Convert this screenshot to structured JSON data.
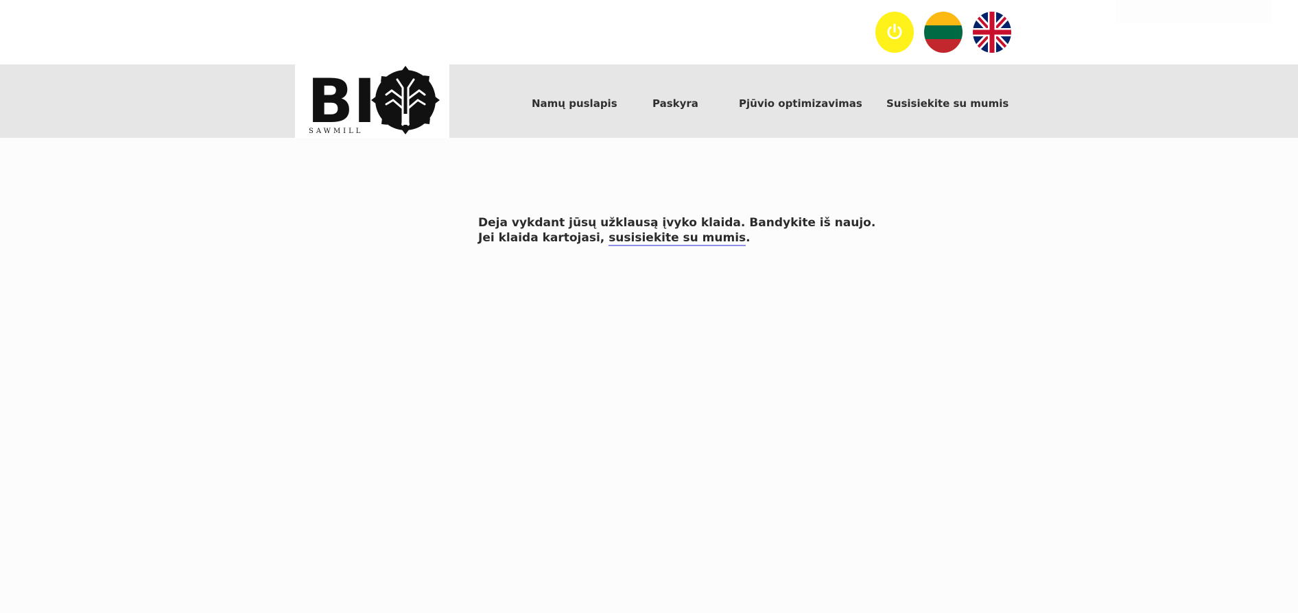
{
  "logo": {
    "text_main": "BI",
    "text_sub": "SAWMILL"
  },
  "nav": {
    "items": [
      {
        "label": "Namų puslapis"
      },
      {
        "label": "Paskyra"
      },
      {
        "label": "Pjūvio optimizavimas"
      },
      {
        "label": "Susisiekite su mumis"
      }
    ]
  },
  "header_icons": {
    "power": {
      "icon": "power-icon",
      "color": "#fff21a"
    },
    "lt_flag": {
      "icon": "lithuania-flag-icon",
      "colors": [
        "#fdb913",
        "#006a44",
        "#c1272d"
      ]
    },
    "en_flag": {
      "icon": "uk-flag-icon",
      "colors": [
        "#012169",
        "#ffffff",
        "#c8102e"
      ]
    }
  },
  "error": {
    "line1": "Deja vykdant jūsų užklausą įvyko klaida. Bandykite iš naujo.",
    "line2_prefix": "Jei klaida kartojasi, ",
    "line2_link": "susisiekite su mumis",
    "line2_suffix": "."
  },
  "colors": {
    "navbar_bg": "#e6e6e6",
    "link_underline": "#8f8fe8"
  }
}
